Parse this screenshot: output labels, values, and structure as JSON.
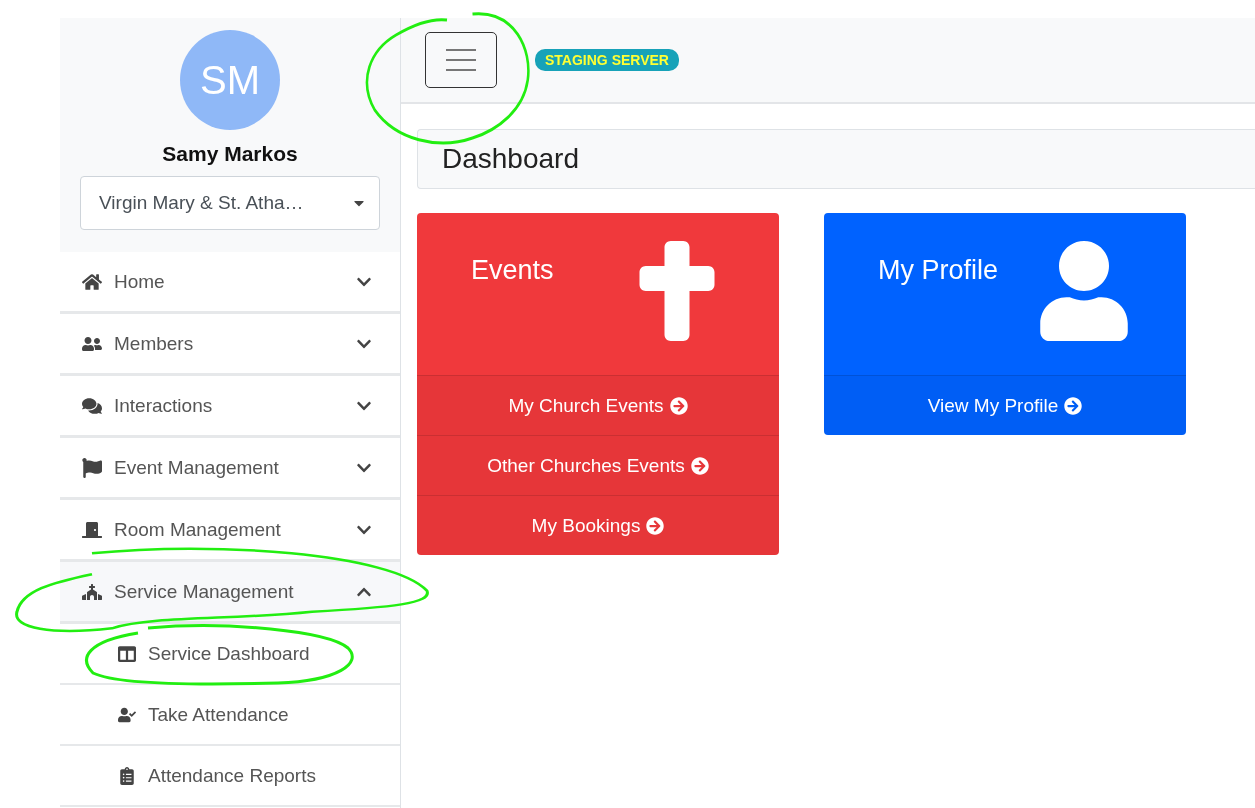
{
  "sidebar": {
    "user": {
      "initials": "SM",
      "name": "Samy Markos"
    },
    "church_select": {
      "value": "Virgin Mary & St. Atha…"
    },
    "items": [
      {
        "label": "Home",
        "expanded": false
      },
      {
        "label": "Members",
        "expanded": false
      },
      {
        "label": "Interactions",
        "expanded": false
      },
      {
        "label": "Event Management",
        "expanded": false
      },
      {
        "label": "Room Management",
        "expanded": false
      },
      {
        "label": "Service Management",
        "expanded": true,
        "children": [
          {
            "label": "Service Dashboard"
          },
          {
            "label": "Take Attendance"
          },
          {
            "label": "Attendance Reports"
          }
        ]
      }
    ]
  },
  "topbar": {
    "badge": "STAGING SERVER"
  },
  "page_title": "Dashboard",
  "cards": [
    {
      "title": "Events",
      "color": "#f0393c",
      "links": [
        "My Church Events",
        "Other Churches Events",
        "My Bookings"
      ]
    },
    {
      "title": "My Profile",
      "color": "#0062ff",
      "links": [
        "View My Profile"
      ]
    }
  ]
}
